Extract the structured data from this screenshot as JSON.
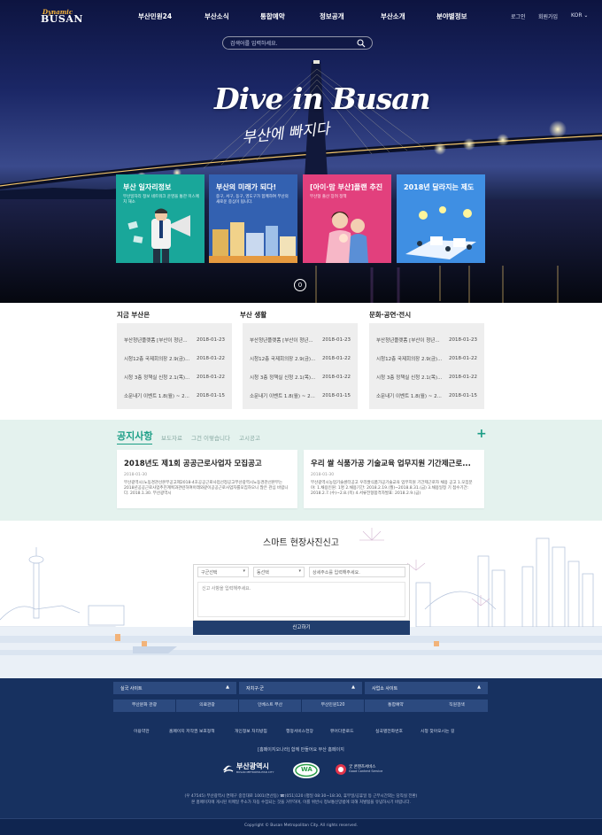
{
  "header": {
    "logo_top": "Dynamic",
    "logo_bottom": "BUSAN",
    "nav": [
      "부산민원24",
      "부산소식",
      "통합예약",
      "정보공개",
      "부산소개",
      "분야별정보"
    ],
    "util": [
      "로그인",
      "회원가입",
      "KOR"
    ]
  },
  "search": {
    "placeholder": "검색어를 입력하세요."
  },
  "hero": {
    "slogan": "Dive in Busan",
    "slogan_ko": "부산에 빠지다",
    "slide_number": "0",
    "cards": [
      {
        "title": "부산 일자리정보",
        "desc": "부산일자리 정보 네트워크 운영을 통한 미스매치 해소",
        "color": "#19a79a"
      },
      {
        "title": "부산의 미래가 되다!",
        "desc": "중구, 서구, 동구, 영도구가 함께하여 부산의 새로운 중심이 됩니다.",
        "color": "#3361b1"
      },
      {
        "title": "[아이·맘 부산]플랜 추진",
        "desc": "부산형 출산 장려 정책",
        "color": "#e2407d"
      },
      {
        "title": "2018년 달라지는 제도",
        "desc": "",
        "color": "#3f8fe3"
      }
    ]
  },
  "news": {
    "columns": [
      {
        "title": "지금 부산은",
        "rows": [
          {
            "text": "부산청년플랫폼 [부산이 청년...",
            "date": "2018-01-23"
          },
          {
            "text": "시청12층 국제회의장 2.9(금)...",
            "date": "2018-01-22"
          },
          {
            "text": "시청 3층 정책실 신청 2.1(목)...",
            "date": "2018-01-22"
          },
          {
            "text": "소문내기 이벤트 1.8(월) ~ 2...",
            "date": "2018-01-15"
          }
        ]
      },
      {
        "title": "부산 생활",
        "rows": [
          {
            "text": "부산청년플랫폼 [부산이 청년...",
            "date": "2018-01-23"
          },
          {
            "text": "시청12층 국제회의장 2.9(금)...",
            "date": "2018-01-22"
          },
          {
            "text": "시청 3층 정책실 신청 2.1(목)...",
            "date": "2018-01-22"
          },
          {
            "text": "소문내기 이벤트 1.8(월) ~ 2...",
            "date": "2018-01-15"
          }
        ]
      },
      {
        "title": "문화·공연·전시",
        "rows": [
          {
            "text": "부산청년플랫폼 [부산이 청년...",
            "date": "2018-01-23"
          },
          {
            "text": "시청12층 국제회의장 2.9(금)...",
            "date": "2018-01-22"
          },
          {
            "text": "시청 3층 정책실 신청 2.1(목)...",
            "date": "2018-01-22"
          },
          {
            "text": "소문내기 이벤트 1.8(월) ~ 2...",
            "date": "2018-01-15"
          }
        ]
      }
    ]
  },
  "notice": {
    "tab_active": "공지사항",
    "tabs": [
      "보도자료",
      "그건 이렇습니다",
      "고시공고"
    ],
    "more": "+",
    "cards": [
      {
        "title": "2018년도 제1회 공공근로사업자 모집공고",
        "date": "2018-01-30",
        "body": "부산광역시(노동경관선본부공고제2018-4호공공근로사업선정공고부산광역시노동경관선본부는 2018년공공근로사업추진계획과관련하여아래와같이공공근로사업자를모집하오니 많은 관심 바랍니다. 2018.1.30. 부산광역시"
      },
      {
        "title": "우리 쌀 식품가공 기술교육 업무지원 기간제근로...",
        "date": "2018-01-30",
        "body": "부산광역시농업기술센터공고 우리쌀식품가공기술교육 업무지원 기간제근로자 채용 공고 1.모집분야: 1.채용인원: 1명 2.채용기간: 2018.2.19.(월)~2018.8.31.(금) 3.채용일정 기 접수기간: 2018.2.7.(수)~2.8.(목) 4.서류전형합격자발표: 2018.2.9.(금)"
      }
    ]
  },
  "smart": {
    "title": "스마트 현장사진신고",
    "select_gu": "구군선택",
    "select_dong": "동선택",
    "address_placeholder": "상세주소를 입력해주세요.",
    "content_placeholder": "신고 사항을 입력해주세요.",
    "submit": "신고하기"
  },
  "footer": {
    "dropdowns": [
      "실국 사이트",
      "자치구·군",
      "사업소 사이트"
    ],
    "buttons": [
      "부산문화 관광",
      "의료관광",
      "인베스트 부산",
      "부산민원120",
      "통합예약",
      "직원검색"
    ],
    "links": [
      "이용약관",
      "홈페이지 저작권 보호정책",
      "개인정보 처리방침",
      "행정서비스헌장",
      "뷰어다운로드",
      "실국별전화번호",
      "시청 찾아오시는 길"
    ],
    "note": "[홈페이지오나라] 함께 만들어요 부산 홈페이지",
    "logos": [
      "부산광역시",
      "BUSAN METROPOLITAN CITY",
      "WA",
      "굿 콘텐츠서비스",
      "Good Content Service"
    ],
    "address": "(우 47545) 부산광역시 연제구 중앙대로 1001(연산동) ☎(051)120 (평일 08:30~18:30, 휴무일/공휴일 등 근무시간외는 당직실 전환)",
    "address2": "본 홈페이지에 게시된 이메일 주소가 자동 수집되는 것을 거부하며, 이를 위반시 정보통신망법에 의해 처벌됨을 유념하시기 바랍니다.",
    "copyright": "Copyright © Busan Metropolitan City. All rights reserved."
  },
  "colors": {
    "navy": "#173160",
    "teal": "#1b9e86",
    "button": "#213e6d"
  }
}
